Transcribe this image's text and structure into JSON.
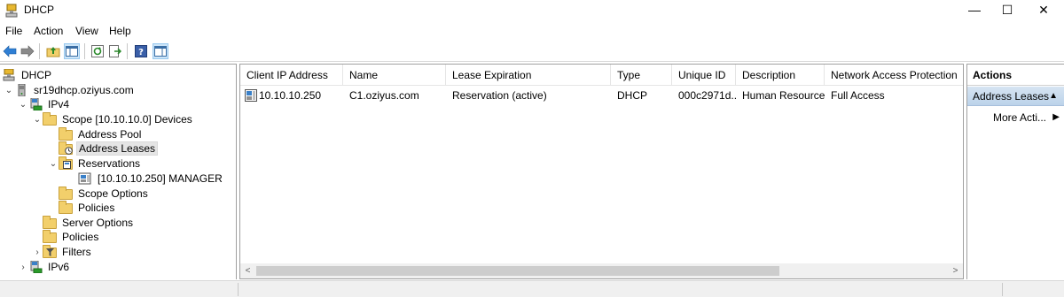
{
  "window": {
    "title": "DHCP",
    "minimize": "—",
    "maximize": "☐",
    "close": "✕"
  },
  "menu": [
    "File",
    "Action",
    "View",
    "Help"
  ],
  "toolbar": {
    "buttons": [
      "back-icon",
      "forward-icon",
      "up-folder-icon",
      "show-hide-console-tree-icon",
      "refresh-icon",
      "export-list-icon",
      "help-icon",
      "show-hide-action-pane-icon"
    ]
  },
  "tree": {
    "root": "DHCP",
    "server": "sr19dhcp.oziyus.com",
    "ipv4": "IPv4",
    "scope": "Scope [10.10.10.0] Devices",
    "address_pool": "Address Pool",
    "address_leases": "Address Leases",
    "reservations": "Reservations",
    "reservation_item": "[10.10.10.250] MANAGER",
    "scope_options": "Scope Options",
    "scope_policies": "Policies",
    "server_options": "Server Options",
    "server_policies": "Policies",
    "filters": "Filters",
    "ipv6": "IPv6"
  },
  "list": {
    "columns": [
      "Client IP Address",
      "Name",
      "Lease Expiration",
      "Type",
      "Unique ID",
      "Description",
      "Network Access Protection"
    ],
    "rows": [
      {
        "client_ip": "10.10.10.250",
        "name": "C1.oziyus.com",
        "lease_expiration": "Reservation (active)",
        "type": "DHCP",
        "unique_id": "000c2971d...",
        "description": "Human Resources",
        "nap": "Full Access"
      }
    ],
    "scroll_left": "<",
    "scroll_right": ">"
  },
  "actions": {
    "title": "Actions",
    "section": "Address Leases",
    "section_arrow": "▲",
    "more": "More Acti...",
    "more_arrow": "▶"
  },
  "colors": {
    "folder": "#f2cf6b",
    "selection": "#e5e5e5",
    "actions_section": "#c9dbee"
  }
}
